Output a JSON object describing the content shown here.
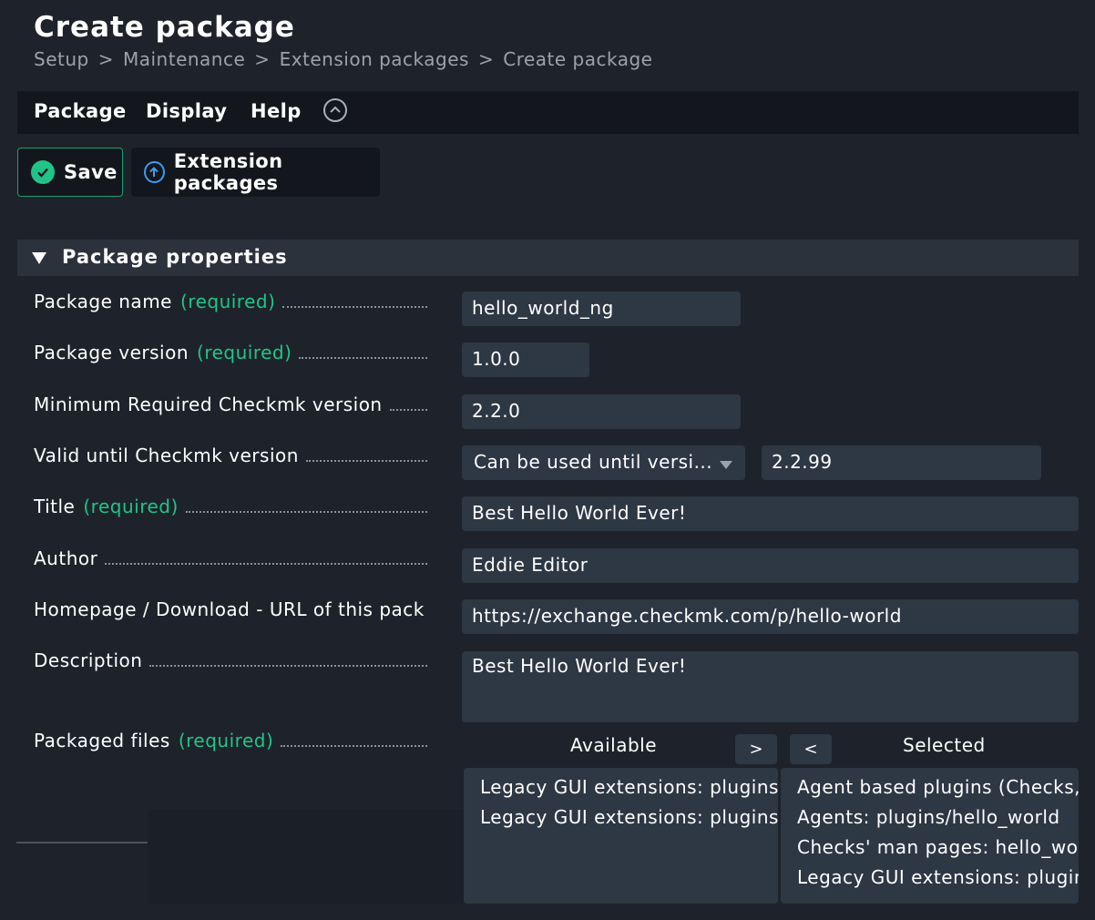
{
  "page": {
    "title": "Create package",
    "breadcrumb": [
      "Setup",
      "Maintenance",
      "Extension packages",
      "Create package"
    ],
    "breadcrumb_sep": ">"
  },
  "menu": {
    "items": [
      "Package",
      "Display",
      "Help"
    ],
    "toggle_icon": "chevron-up-icon"
  },
  "toolbar": {
    "save_label": "Save",
    "save_icon": "check-circle-icon",
    "extension_label": "Extension packages",
    "extension_icon": "arrow-up-circle-icon"
  },
  "section": {
    "title": "Package properties",
    "collapse_icon": "triangle-down-icon"
  },
  "required_marker": "(required)",
  "fields": {
    "package_name": {
      "label": "Package name",
      "value": "hello_world_ng"
    },
    "package_version": {
      "label": "Package version",
      "value": "1.0.0"
    },
    "min_version": {
      "label": "Minimum Required Checkmk version",
      "value": "2.2.0"
    },
    "valid_until": {
      "label": "Valid until Checkmk version",
      "select_value": "Can be used until versi...",
      "value": "2.2.99"
    },
    "title": {
      "label": "Title",
      "value": "Best Hello World Ever!"
    },
    "author": {
      "label": "Author",
      "value": "Eddie Editor"
    },
    "homepage": {
      "label": "Homepage / Download - URL of this pack",
      "value": "https://exchange.checkmk.com/p/hello-world"
    },
    "description": {
      "label": "Description",
      "value": "Best Hello World Ever!"
    },
    "packaged_files": {
      "label": "Packaged files",
      "available_header": "Available",
      "selected_header": "Selected",
      "add_button": ">",
      "remove_button": "<",
      "available": [
        "Legacy GUI extensions: plugins/",
        "Legacy GUI extensions: plugins/"
      ],
      "selected": [
        "Agent based plugins (Checks,",
        "Agents: plugins/hello_world",
        "Checks' man pages: hello_wor",
        "Legacy GUI extensions: plugin"
      ]
    }
  },
  "colors": {
    "background": "#1e232b",
    "menubar": "#13171d",
    "input": "#2e3744",
    "accent_green": "#21c488",
    "accent_blue": "#3b9cf0"
  }
}
